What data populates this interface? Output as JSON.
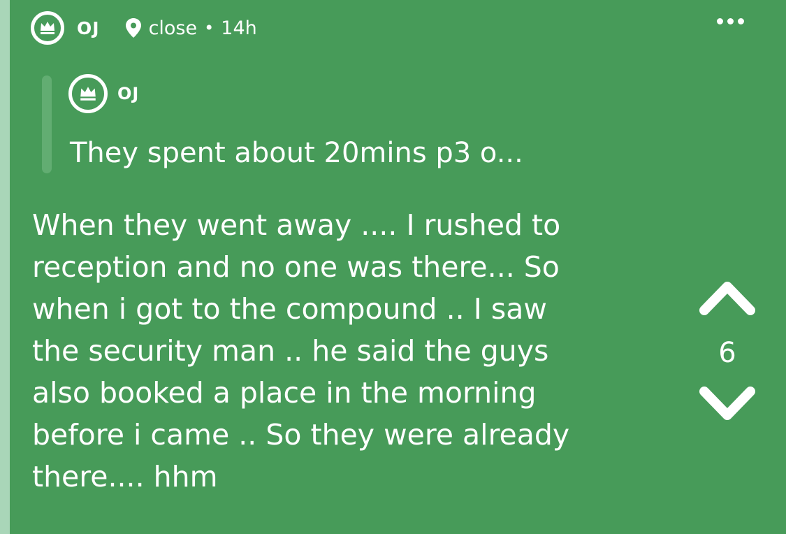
{
  "colors": {
    "background": "#479b59",
    "accent_strip": "#a9d6b8",
    "quote_bar": "#62ad72",
    "text": "#ffffff"
  },
  "header": {
    "badge_icon": "crown-icon",
    "username": "OJ",
    "location_icon": "location-pin-icon",
    "location": "close",
    "separator": "•",
    "time": "14h",
    "more_icon": "more-horizontal-icon"
  },
  "quote": {
    "badge_icon": "crown-icon",
    "username": "OJ",
    "text": "They spent about 20mins p3 o..."
  },
  "post": {
    "lines": [
      "When they went away .... I rushed to",
      "reception and no one was there... So",
      "when i got to the compound .. I saw",
      "the security man .. he said the guys",
      "also booked a place in the morning",
      "before i came .. So they were already",
      "there.... hhm"
    ]
  },
  "votes": {
    "upvote_icon": "chevron-up-icon",
    "count": "6",
    "downvote_icon": "chevron-down-icon"
  }
}
